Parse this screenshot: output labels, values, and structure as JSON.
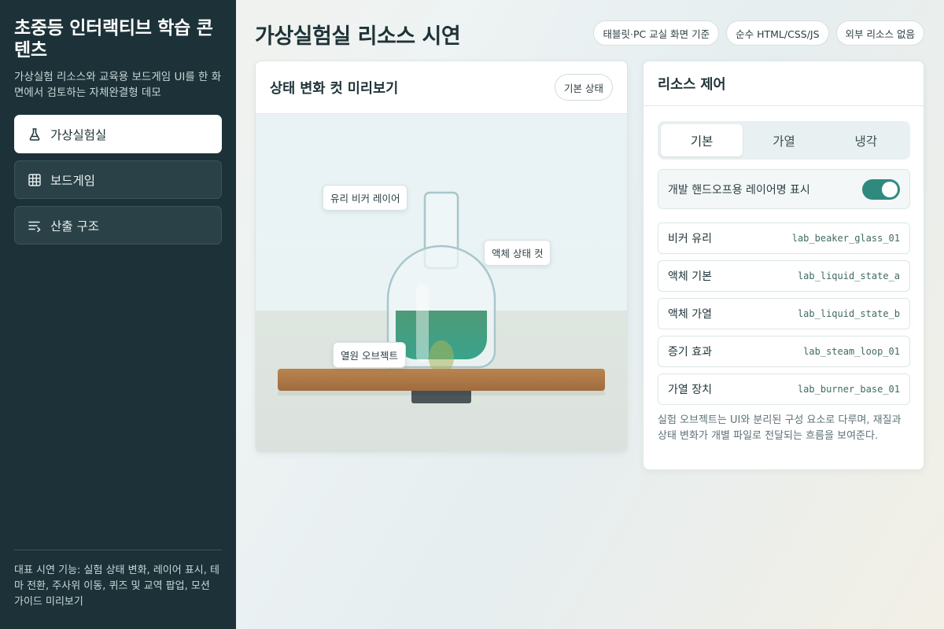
{
  "sidebar": {
    "title": "초중등 인터랙티브 학습 콘텐츠",
    "description": "가상실험 리소스와 교육용 보드게임 UI를 한 화면에서 검토하는 자체완결형 데모",
    "nav": [
      {
        "label": "가상실험실",
        "icon": "flask-icon",
        "active": true
      },
      {
        "label": "보드게임",
        "icon": "grid-icon",
        "active": false
      },
      {
        "label": "산출 구조",
        "icon": "list-arrow-icon",
        "active": false
      }
    ],
    "footer": "대표 시연 기능: 실험 상태 변화, 레이어 표시, 테마 전환, 주사위 이동, 퀴즈 및 교역 팝업, 모션 가이드 미리보기"
  },
  "header": {
    "title": "가상실험실 리소스 시연",
    "chips": [
      "태블릿·PC 교실 화면 기준",
      "순수 HTML/CSS/JS",
      "외부 리소스 없음"
    ]
  },
  "preview": {
    "title": "상태 변화 컷 미리보기",
    "state_pill": "기본 상태",
    "callouts": {
      "beaker": "유리 비커 레이어",
      "liquid": "액체 상태 컷",
      "heat": "열원 오브젝트"
    },
    "colors": {
      "liquid": "#3f9f86",
      "shelf": "#b07a4a",
      "glass": "#a9c6cc"
    }
  },
  "resources": {
    "title": "리소스 제어",
    "tabs": [
      {
        "label": "기본",
        "active": true
      },
      {
        "label": "가열",
        "active": false
      },
      {
        "label": "냉각",
        "active": false
      }
    ],
    "toggle": {
      "label": "개발 핸드오프용 레이어명 표시",
      "on": true
    },
    "items": [
      {
        "label": "비커 유리",
        "file": "lab_beaker_glass_01"
      },
      {
        "label": "액체 기본",
        "file": "lab_liquid_state_a"
      },
      {
        "label": "액체 가열",
        "file": "lab_liquid_state_b"
      },
      {
        "label": "증기 효과",
        "file": "lab_steam_loop_01"
      },
      {
        "label": "가열 장치",
        "file": "lab_burner_base_01"
      }
    ],
    "note": "실험 오브젝트는 UI와 분리된 구성 요소로 다루며, 재질과 상태 변화가 개별 파일로 전달되는 흐름을 보여준다."
  }
}
